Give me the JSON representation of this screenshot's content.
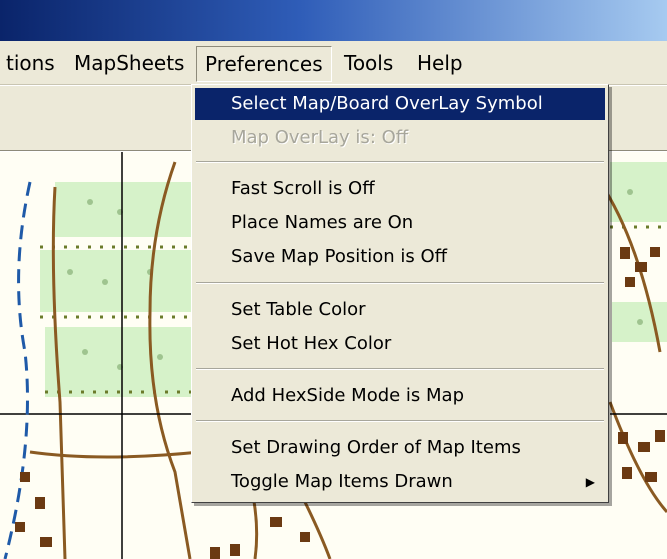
{
  "menubar": {
    "items": [
      {
        "label": "tions"
      },
      {
        "label": "MapSheets"
      },
      {
        "label": "Preferences"
      },
      {
        "label": "Tools"
      },
      {
        "label": "Help"
      }
    ]
  },
  "preferences_menu": {
    "items": [
      {
        "label": "Select Map/Board OverLay Symbol",
        "state": "highlighted"
      },
      {
        "label": "Map OverLay is: Off",
        "state": "disabled"
      },
      {
        "label": "Fast Scroll is Off"
      },
      {
        "label": "Place Names are On"
      },
      {
        "label": "Save Map Position is Off"
      },
      {
        "label": "Set Table Color"
      },
      {
        "label": "Set Hot Hex Color"
      },
      {
        "label": "Add HexSide Mode is Map"
      },
      {
        "label": "Set Drawing Order of Map Items"
      },
      {
        "label": "Toggle Map Items Drawn",
        "submenu_arrow": "▶"
      }
    ]
  },
  "colors": {
    "title_bar": "#0a246a",
    "menu_face": "#ece9d8",
    "menu_highlight": "#0a246a",
    "disabled_text": "#a7a69b",
    "map_background": "#fffef4",
    "map_green": "#d6f2c9",
    "map_brown": "#8a5a22",
    "river_blue": "#1f5aa8"
  }
}
